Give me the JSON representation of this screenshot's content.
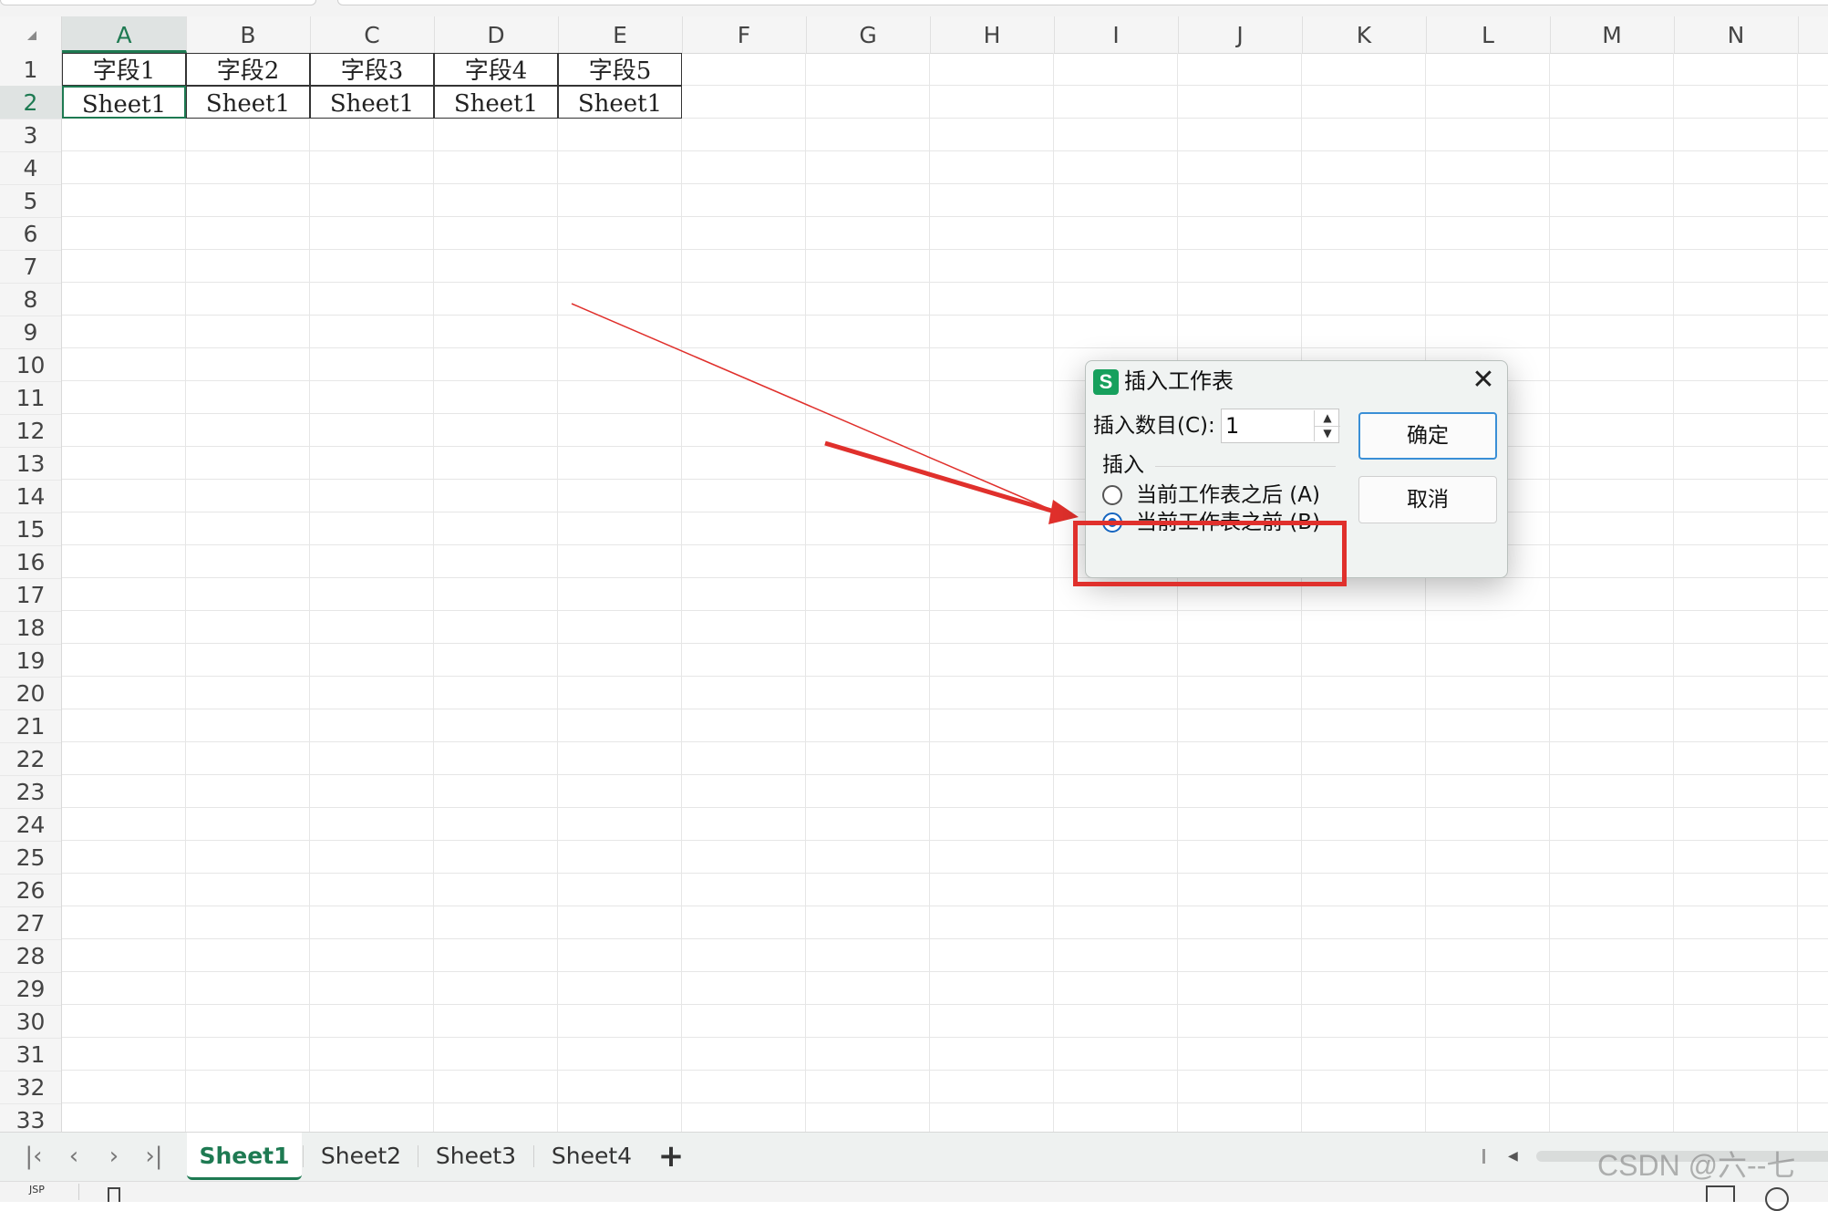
{
  "columns": [
    "A",
    "B",
    "C",
    "D",
    "E",
    "F",
    "G",
    "H",
    "I",
    "J",
    "K",
    "L",
    "M",
    "N"
  ],
  "rows": [
    "1",
    "2",
    "3",
    "4",
    "5",
    "6",
    "7",
    "8",
    "9",
    "10",
    "11",
    "12",
    "13",
    "14",
    "15",
    "16",
    "17",
    "18",
    "19",
    "20",
    "21",
    "22",
    "23",
    "24",
    "25",
    "26",
    "27",
    "28",
    "29",
    "30",
    "31",
    "32",
    "33"
  ],
  "active_column": "A",
  "active_row": "2",
  "table": {
    "headers": [
      "字段1",
      "字段2",
      "字段3",
      "字段4",
      "字段5"
    ],
    "values": [
      "Sheet1",
      "Sheet1",
      "Sheet1",
      "Sheet1",
      "Sheet1"
    ]
  },
  "dialog": {
    "app_icon": "S",
    "title": "插入工作表",
    "count_label": "插入数目(C):",
    "count_value": "1",
    "group_label": "插入",
    "option_after": "当前工作表之后 (A)",
    "option_before": "当前工作表之前 (B)",
    "selected_option": "before",
    "ok_label": "确定",
    "cancel_label": "取消"
  },
  "sheet_tabs": [
    "Sheet1",
    "Sheet2",
    "Sheet3",
    "Sheet4"
  ],
  "active_sheet": "Sheet1",
  "add_tab_symbol": "+",
  "watermark": "CSDN @六--七",
  "status": {
    "ime": "JSP"
  },
  "colors": {
    "accent_green": "#1e7a52",
    "annotation_red": "#e0302c",
    "dialog_blue": "#1565c0"
  },
  "icons": [
    "select-all-triangle-icon",
    "app-s-icon",
    "close-icon",
    "spin-up-icon",
    "spin-down-icon",
    "first-sheet-icon",
    "prev-sheet-icon",
    "next-sheet-icon",
    "last-sheet-icon",
    "add-sheet-icon",
    "scroll-left-icon"
  ]
}
